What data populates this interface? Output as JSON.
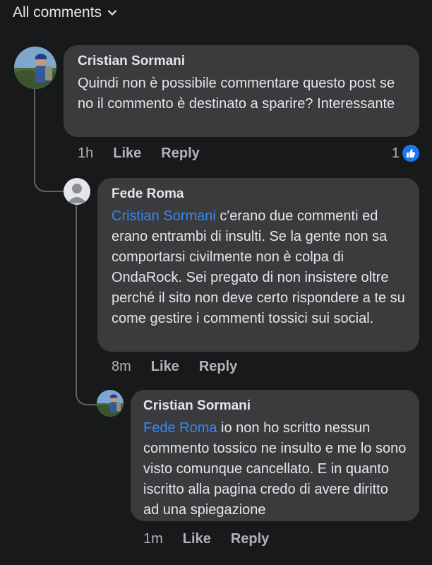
{
  "header": {
    "label": "All comments"
  },
  "comments": [
    {
      "author": "Cristian Sormani",
      "mention": "",
      "text": "Quindi non è possibile commentare questo post se no il commento è destinato a sparire? Interessante",
      "time": "1h",
      "like_label": "Like",
      "reply_label": "Reply",
      "reactions": "1"
    },
    {
      "author": "Fede Roma",
      "mention": "Cristian Sormani",
      "text": " c'erano due commenti ed erano entrambi di insulti. Se la gente non sa comportarsi civilmente non è colpa di OndaRock. Sei pregato di non insistere oltre perché il sito non deve certo rispondere a te su come gestire i commenti tossici sui social.",
      "time": "8m",
      "like_label": "Like",
      "reply_label": "Reply"
    },
    {
      "author": "Cristian Sormani",
      "mention": "Fede Roma",
      "text": " io non ho scritto nessun commento tossico ne insulto e me lo sono visto comunque cancellato. E in quanto iscritto alla pagina credo di avere diritto ad una spiegazione",
      "time": "1m",
      "like_label": "Like",
      "reply_label": "Reply"
    }
  ],
  "colors": {
    "background": "#18191a",
    "bubble": "#3a3b3c",
    "mention": "#2e89ff",
    "like_badge": "#1877f2"
  }
}
